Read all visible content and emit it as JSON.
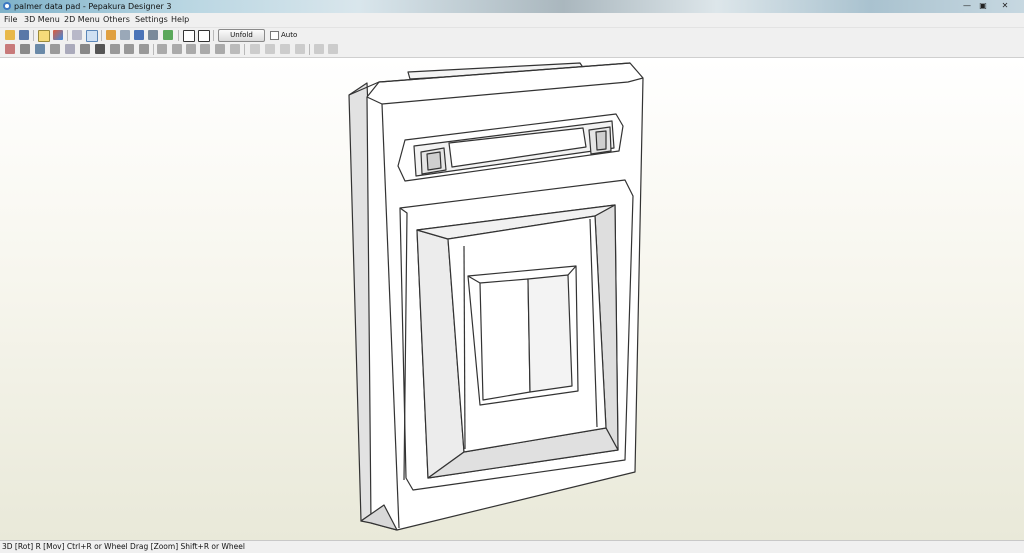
{
  "window": {
    "title": "palmer data pad - Pepakura Designer 3",
    "controls": {
      "minimize": "—",
      "maximize": "▣",
      "close": "✕"
    }
  },
  "menu": {
    "file": "File",
    "menu3d": "3D Menu",
    "menu2d": "2D Menu",
    "others": "Others",
    "settings": "Settings",
    "help": "Help"
  },
  "toolbar": {
    "unfold_label": "Unfold",
    "auto_label": "Auto",
    "auto_checked": false,
    "icons_row1": [
      "open-icon",
      "save-icon",
      "color-mode-icon",
      "texture-icon",
      "wireframe-icon",
      "select-mode-icon",
      "pencil-icon",
      "paint-bucket-icon",
      "rotate-axis-icon",
      "view-front-icon",
      "model-tree-icon",
      "window-single-icon",
      "window-split-icon"
    ],
    "icons_row2": [
      "edit-part-icon",
      "join-edge-icon",
      "texture-setting-icon",
      "flap-icon",
      "cylinder-icon",
      "cut-line-icon",
      "undo-icon",
      "redo-icon",
      "move-face-icon",
      "split-face-icon",
      "group-icon",
      "layout-icon",
      "print-icon",
      "align-left-icon",
      "align-center-icon",
      "align-top-icon",
      "align-right-icon",
      "zoom-fit-icon",
      "zoom-reset-icon"
    ]
  },
  "status": {
    "text": "3D [Rot] R [Mov] Ctrl+R or Wheel Drag [Zoom] Shift+R or Wheel"
  },
  "colors": {
    "toolbar_bg": "#f0f0f0",
    "viewport_top": "#ffffff",
    "viewport_bottom": "#e9e9d9",
    "model_stroke": "#333333"
  }
}
